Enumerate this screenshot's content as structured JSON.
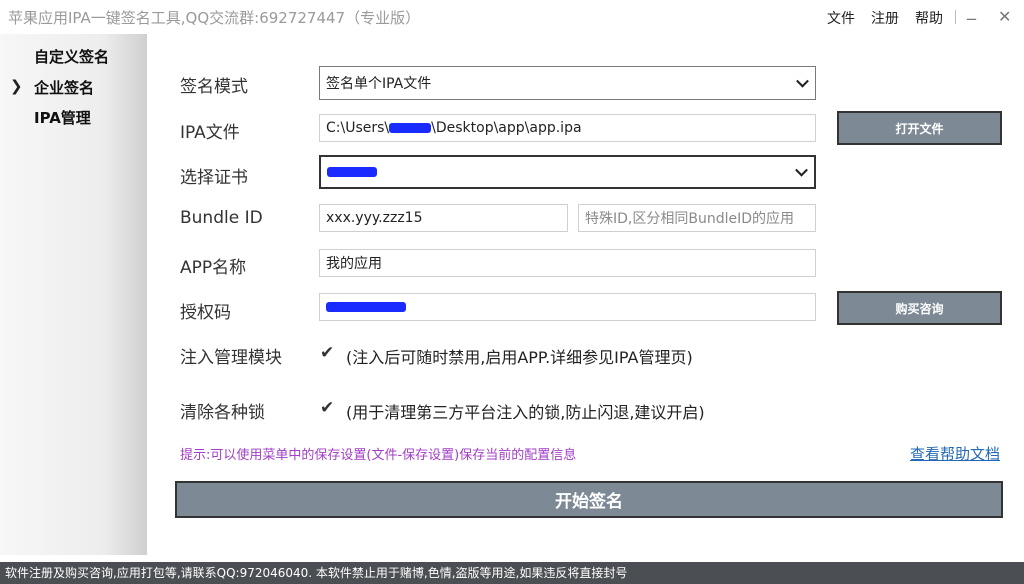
{
  "window": {
    "title": "苹果应用IPA一键签名工具,QQ交流群:692727447（专业版）",
    "menu": [
      "文件",
      "注册",
      "帮助"
    ],
    "minimize_glyph": "_",
    "close_glyph": "✕"
  },
  "sidebar": {
    "arrow": "❯",
    "items": [
      {
        "label": "自定义签名"
      },
      {
        "label": "企业签名",
        "selected": true
      },
      {
        "label": "IPA管理"
      }
    ]
  },
  "form": {
    "sign_mode": {
      "label": "签名模式",
      "value": "签名单个IPA文件"
    },
    "ipa_file": {
      "label": "IPA文件",
      "value_prefix": "C:\\Users\\",
      "value_suffix": "\\Desktop\\app\\app.ipa",
      "button": "打开文件"
    },
    "certificate": {
      "label": "选择证书"
    },
    "bundle_id": {
      "label": "Bundle ID",
      "value": "xxx.yyy.zzz15",
      "extra_placeholder": "特殊ID,区分相同BundleID的应用"
    },
    "app_name": {
      "label": "APP名称",
      "value": "我的应用"
    },
    "auth_code": {
      "label": "授权码",
      "button": "购买咨询"
    },
    "inject": {
      "label": "注入管理模块",
      "checked": true,
      "text": "(注入后可随时禁用,启用APP.详细参见IPA管理页)"
    },
    "clear_locks": {
      "label": "清除各种锁",
      "checked": true,
      "text": "(用于清理第三方平台注入的锁,防止闪退,建议开启)"
    }
  },
  "hint": "提示:可以使用菜单中的保存设置(文件-保存设置)保存当前的配置信息",
  "help_link": "查看帮助文档",
  "start_button": "开始签名",
  "status_bar": "软件注册及购买咨询,应用打包等,请联系QQ:972046040.  本软件禁止用于赌博,色情,盗版等用途,如果违反将直接封号",
  "colors": {
    "button_bg": "#7d8a95",
    "hint": "#a23ec7",
    "link": "#2369b6",
    "status_bg": "#4b4e52",
    "redaction": "#1a2bff"
  }
}
